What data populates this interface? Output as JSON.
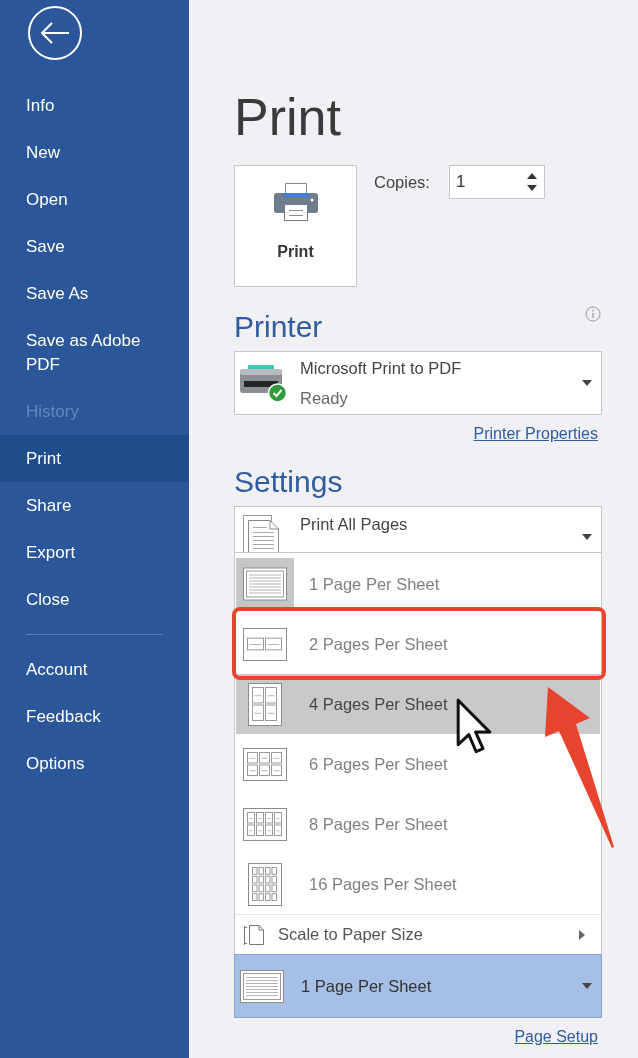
{
  "sidebar": {
    "groups": [
      [
        {
          "label": "Info",
          "selected": false,
          "disabled": false
        },
        {
          "label": "New",
          "selected": false,
          "disabled": false
        },
        {
          "label": "Open",
          "selected": false,
          "disabled": false
        },
        {
          "label": "Save",
          "selected": false,
          "disabled": false
        },
        {
          "label": "Save As",
          "selected": false,
          "disabled": false
        },
        {
          "label": "Save as Adobe PDF",
          "selected": false,
          "disabled": false
        },
        {
          "label": "History",
          "selected": false,
          "disabled": true
        },
        {
          "label": "Print",
          "selected": true,
          "disabled": false
        },
        {
          "label": "Share",
          "selected": false,
          "disabled": false
        },
        {
          "label": "Export",
          "selected": false,
          "disabled": false
        },
        {
          "label": "Close",
          "selected": false,
          "disabled": false
        }
      ],
      [
        {
          "label": "Account",
          "selected": false,
          "disabled": false
        },
        {
          "label": "Feedback",
          "selected": false,
          "disabled": false
        },
        {
          "label": "Options",
          "selected": false,
          "disabled": false
        }
      ]
    ]
  },
  "page_title": "Print",
  "print_button": {
    "label": "Print"
  },
  "copies": {
    "label": "Copies:",
    "value": "1"
  },
  "printer": {
    "heading": "Printer",
    "name": "Microsoft Print to PDF",
    "status": "Ready",
    "link": "Printer Properties"
  },
  "settings": {
    "heading": "Settings",
    "print_range": {
      "title": "Print All Pages"
    },
    "pages_per_sheet": {
      "open": true,
      "kind": "one",
      "value": "1 Page Per Sheet",
      "options": [
        {
          "label": "1 Page Per Sheet",
          "kind": "one",
          "selected": true,
          "hovered": false,
          "annotated": false
        },
        {
          "label": "2 Pages Per Sheet",
          "kind": "two",
          "selected": false,
          "hovered": false,
          "annotated": true
        },
        {
          "label": "4 Pages Per Sheet",
          "kind": "four",
          "selected": false,
          "hovered": true,
          "annotated": false
        },
        {
          "label": "6 Pages Per Sheet",
          "kind": "six",
          "selected": false,
          "hovered": false,
          "annotated": false
        },
        {
          "label": "8 Pages Per Sheet",
          "kind": "eight",
          "selected": false,
          "hovered": false,
          "annotated": false
        },
        {
          "label": "16 Pages Per Sheet",
          "kind": "sixteen",
          "selected": false,
          "hovered": false,
          "annotated": false
        }
      ],
      "footer_item": "Scale to Paper Size"
    },
    "link": "Page Setup"
  }
}
